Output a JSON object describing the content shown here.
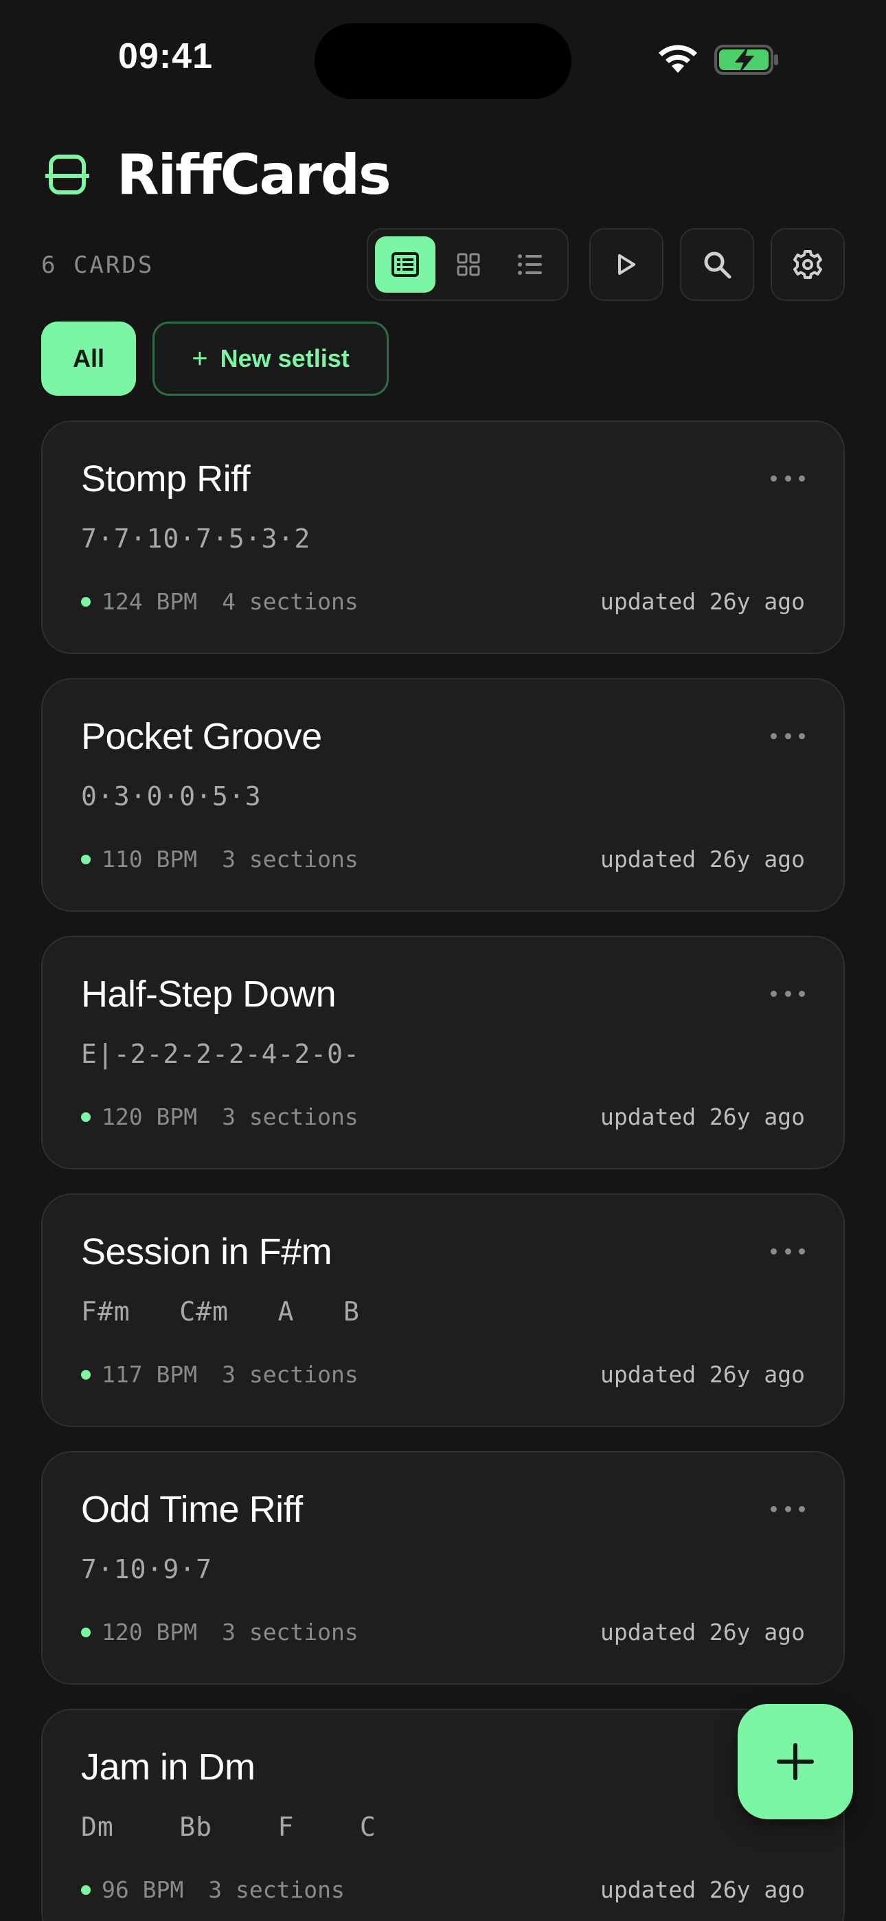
{
  "status_bar": {
    "time": "09:41"
  },
  "header": {
    "title": "RiffCards",
    "card_count": "6 CARDS"
  },
  "filters": {
    "all_label": "All",
    "new_setlist_label": "New setlist",
    "plus_glyph": "+"
  },
  "accent_color": "#7cf5a4",
  "cards": [
    {
      "title": "Stomp Riff",
      "tab": "7·7·10·7·5·3·2",
      "bpm": "124 BPM",
      "sections": "4 sections",
      "updated": "updated 26y ago"
    },
    {
      "title": "Pocket Groove",
      "tab": "0·3·0·0·5·3",
      "bpm": "110 BPM",
      "sections": "3 sections",
      "updated": "updated 26y ago"
    },
    {
      "title": "Half-Step Down",
      "tab": "E|-2-2-2-2-4-2-0-",
      "bpm": "120 BPM",
      "sections": "3 sections",
      "updated": "updated 26y ago"
    },
    {
      "title": "Session in F#m",
      "tab": "F#m   C#m   A   B",
      "bpm": "117 BPM",
      "sections": "3 sections",
      "updated": "updated 26y ago"
    },
    {
      "title": "Odd Time Riff",
      "tab": "7·10·9·7",
      "bpm": "120 BPM",
      "sections": "3 sections",
      "updated": "updated 26y ago"
    },
    {
      "title": "Jam in Dm",
      "tab": "Dm    Bb    F    C",
      "bpm": "96 BPM",
      "sections": "3 sections",
      "updated": "updated 26y ago"
    }
  ]
}
